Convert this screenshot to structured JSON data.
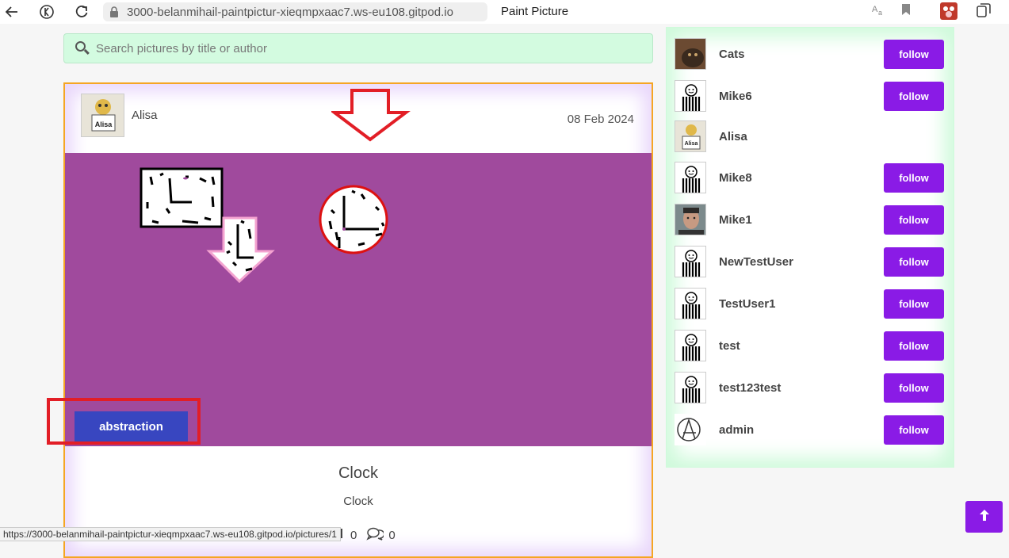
{
  "browser": {
    "url": "3000-belanmihail-paintpictur-xieqmpxaac7.ws-eu108.gitpod.io",
    "tab_title": "Paint Picture",
    "status_url": "https://3000-belanmihail-paintpictur-xieqmpxaac7.ws-eu108.gitpod.io/pictures/1"
  },
  "search": {
    "placeholder": "Search pictures by title or author"
  },
  "post": {
    "author": "Alisa",
    "date": "08 Feb 2024",
    "tag": "abstraction",
    "title": "Clock",
    "description": "Clock",
    "likes": "0",
    "comments": "0"
  },
  "sidebar": {
    "users": [
      {
        "name": "Cats",
        "follow": "follow",
        "avatar": "cat-photo"
      },
      {
        "name": "Mike6",
        "follow": "follow",
        "avatar": "striped-figure"
      },
      {
        "name": "Alisa",
        "follow": "",
        "avatar": "alisa-badge"
      },
      {
        "name": "Mike8",
        "follow": "follow",
        "avatar": "striped-figure"
      },
      {
        "name": "Mike1",
        "follow": "follow",
        "avatar": "man-photo"
      },
      {
        "name": "NewTestUser",
        "follow": "follow",
        "avatar": "striped-figure"
      },
      {
        "name": "TestUser1",
        "follow": "follow",
        "avatar": "striped-figure"
      },
      {
        "name": "test",
        "follow": "follow",
        "avatar": "striped-figure"
      },
      {
        "name": "test123test",
        "follow": "follow",
        "avatar": "striped-figure"
      },
      {
        "name": "admin",
        "follow": "follow",
        "avatar": "anarchy-symbol"
      }
    ]
  },
  "colors": {
    "accent": "#8a1be6",
    "canvas": "#a04a9d",
    "tag": "#3846c0",
    "highlight": "#e21e26"
  },
  "scroll_top": {
    "icon": "arrow-up-icon"
  }
}
